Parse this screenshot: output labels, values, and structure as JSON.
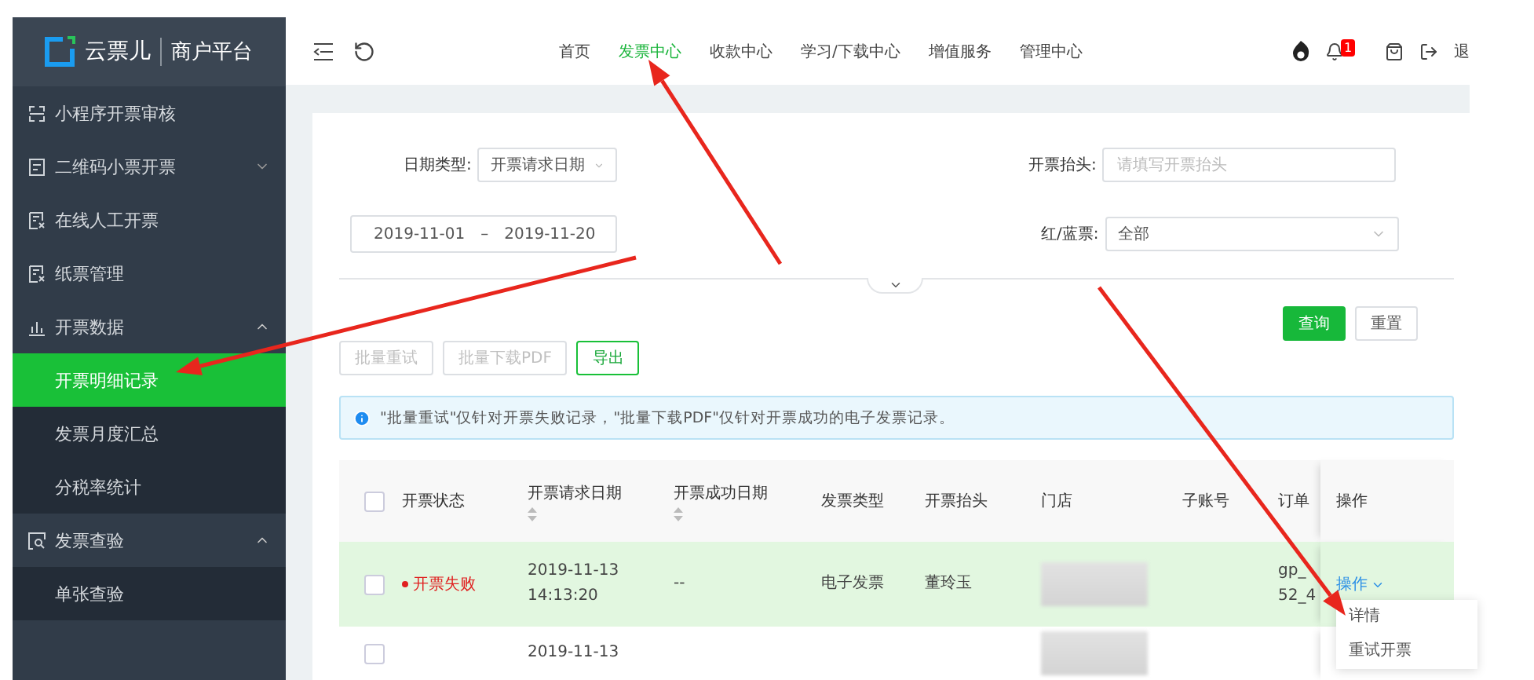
{
  "sidebar": {
    "logo": {
      "name": "云票儿",
      "subtitle": "商户平台"
    },
    "items": [
      {
        "label": "小程序开票审核",
        "kind": "link",
        "selected": false
      },
      {
        "label": "二维码小票开票",
        "kind": "group",
        "expanded": false,
        "selected": false
      },
      {
        "label": "在线人工开票",
        "kind": "link",
        "selected": false
      },
      {
        "label": "纸票管理",
        "kind": "link",
        "selected": false
      },
      {
        "label": "开票数据",
        "kind": "group",
        "expanded": true,
        "selected": false,
        "children": [
          {
            "label": "开票明细记录",
            "selected": true
          },
          {
            "label": "发票月度汇总",
            "selected": false
          },
          {
            "label": "分税率统计",
            "selected": false
          }
        ]
      },
      {
        "label": "发票查验",
        "kind": "group",
        "expanded": true,
        "selected": false,
        "children": [
          {
            "label": "单张查验",
            "selected": false
          }
        ]
      }
    ]
  },
  "header": {
    "nav": [
      {
        "label": "首页",
        "selected": false
      },
      {
        "label": "发票中心",
        "selected": true
      },
      {
        "label": "收款中心",
        "selected": false
      },
      {
        "label": "学习/下载中心",
        "selected": false
      },
      {
        "label": "增值服务",
        "selected": false
      },
      {
        "label": "管理中心",
        "selected": false
      }
    ],
    "notification_count": "1",
    "logout": "退"
  },
  "filters": {
    "date_type": {
      "label": "日期类型:",
      "value": "开票请求日期"
    },
    "title": {
      "label": "开票抬头:",
      "placeholder": "请填写开票抬头"
    },
    "date_range": {
      "start": "2019-11-01",
      "separator": "–",
      "end": "2019-11-20"
    },
    "red_blue": {
      "label": "红/蓝票:",
      "value": "全部"
    }
  },
  "buttons": {
    "query": "查询",
    "reset": "重置"
  },
  "batch_buttons": [
    {
      "label": "批量重试",
      "disabled": true
    },
    {
      "label": "批量下载PDF",
      "disabled": true
    },
    {
      "label": "导出",
      "disabled": false
    }
  ],
  "notice": "\"批量重试\"仅针对开票失败记录，\"批量下载PDF\"仅针对开票成功的电子发票记录。",
  "table": {
    "all_checked": false,
    "columns": [
      {
        "label": "开票状态",
        "sortable": false
      },
      {
        "label": "开票请求日期",
        "sortable": true
      },
      {
        "label": "开票成功日期",
        "sortable": true
      },
      {
        "label": "发票类型",
        "sortable": false
      },
      {
        "label": "开票抬头",
        "sortable": false
      },
      {
        "label": "门店",
        "sortable": false
      },
      {
        "label": "子账号",
        "sortable": false
      },
      {
        "label": "订单",
        "sortable": false
      },
      {
        "label": "操作",
        "sortable": false
      }
    ],
    "rows": [
      {
        "checked": false,
        "highlighted": true,
        "status": "开票失败",
        "request_date": [
          "2019-11-13",
          "14:13:20"
        ],
        "success_date": "--",
        "type": "电子发票",
        "title": "董玲玉",
        "order": [
          "gp_",
          "52_4"
        ],
        "action": "操作",
        "menu": {
          "open": true,
          "items": [
            "详情",
            "重试开票"
          ]
        }
      },
      {
        "checked": false,
        "highlighted": false,
        "request_date": [
          "2019-11-13"
        ]
      }
    ]
  }
}
